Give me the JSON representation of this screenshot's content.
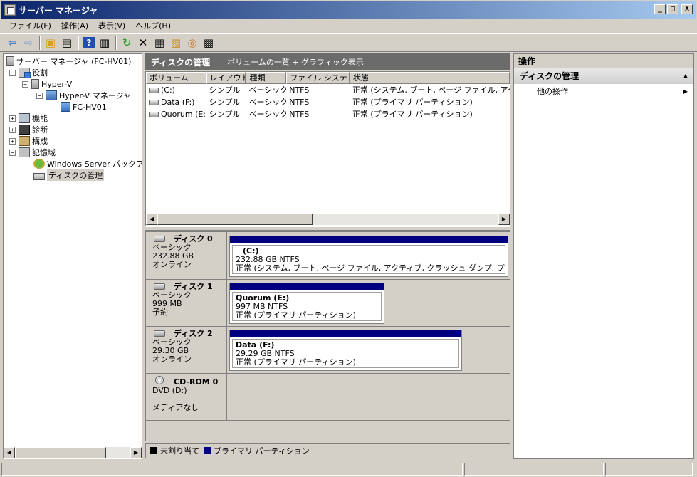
{
  "window": {
    "title": "サーバー マネージャ",
    "controls": [
      "_",
      "□",
      "X"
    ]
  },
  "menu": [
    "ファイル(F)",
    "操作(A)",
    "表示(V)",
    "ヘルプ(H)"
  ],
  "toolbar": {
    "icons": [
      "back-arrow-icon",
      "forward-arrow-icon",
      "up-folder-icon",
      "show-hide-tree-icon",
      "help-icon",
      "show-hide-action-icon",
      "refresh-icon",
      "delete-icon",
      "properties-icon",
      "open-icon",
      "search-icon",
      "settings-icon"
    ]
  },
  "tree": {
    "root": "サーバー マネージャ (FC-HV01)",
    "roles": "役割",
    "hyperv": "Hyper-V",
    "hyperv_manager": "Hyper-V マネージャ",
    "host": "FC-HV01",
    "features": "機能",
    "diagnostics": "診断",
    "configuration": "構成",
    "storage": "記憶域",
    "backup": "Windows Server バックアップ",
    "disk_mgmt": "ディスクの管理"
  },
  "center": {
    "title": "ディスクの管理",
    "subtitle": "ボリュームの一覧 + グラフィック表示",
    "columns": [
      "ボリューム",
      "レイアウト",
      "種類",
      "ファイル システム",
      "状態"
    ],
    "rows": [
      [
        "(C:)",
        "シンプル",
        "ベーシック",
        "NTFS",
        "正常 (システム, ブート, ページ ファイル, アクティブ"
      ],
      [
        "Data (F:)",
        "シンプル",
        "ベーシック",
        "NTFS",
        "正常 (プライマリ パーティション)"
      ],
      [
        "Quorum (E:)",
        "シンプル",
        "ベーシック",
        "NTFS",
        "正常 (プライマリ パーティション)"
      ]
    ]
  },
  "disks": [
    {
      "name": "ディスク 0",
      "type": "ベーシック",
      "size": "232.88 GB",
      "state": "オンライン",
      "partition": {
        "name": "(C:)",
        "detail": "232.88 GB NTFS",
        "status": "正常 (システム, ブート, ページ ファイル, アクティブ, クラッシュ ダンプ, プライマリ パーティション)"
      }
    },
    {
      "name": "ディスク 1",
      "type": "ベーシック",
      "size": "999 MB",
      "state": "予約",
      "partition": {
        "name": "Quorum (E:)",
        "detail": "997 MB NTFS",
        "status": "正常 (プライマリ パーティション)"
      }
    },
    {
      "name": "ディスク 2",
      "type": "ベーシック",
      "size": "29.30 GB",
      "state": "オンライン",
      "partition": {
        "name": "Data (F:)",
        "detail": "29.29 GB NTFS",
        "status": "正常 (プライマリ パーティション)"
      }
    },
    {
      "name": "CD-ROM 0",
      "type": "DVD (D:)",
      "state": "メディアなし"
    }
  ],
  "legend": [
    {
      "label": "未割り当て",
      "color": "#000000"
    },
    {
      "label": "プライマリ パーティション",
      "color": "#000080"
    }
  ],
  "actions": {
    "header": "操作",
    "section": "ディスクの管理",
    "item": "他の操作"
  }
}
